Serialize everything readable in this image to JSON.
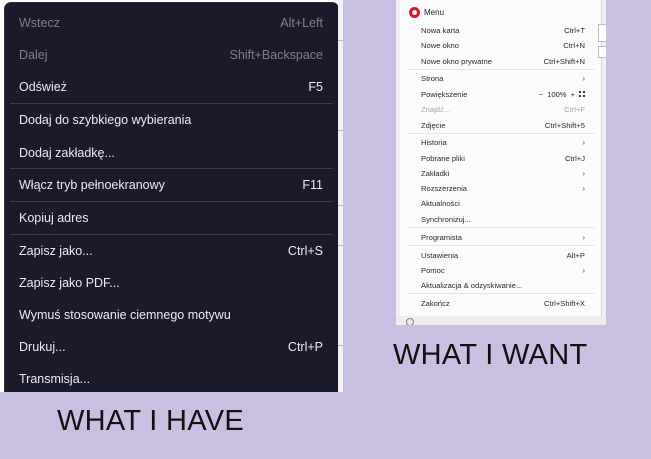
{
  "dark_menu": {
    "items": [
      {
        "label": "Wstecz",
        "shortcut": "Alt+Left",
        "disabled": true
      },
      {
        "label": "Dalej",
        "shortcut": "Shift+Backspace",
        "disabled": true
      },
      {
        "label": "Odśwież",
        "shortcut": "F5",
        "disabled": false
      },
      {
        "label": "Dodaj do szybkiego wybierania",
        "shortcut": "",
        "disabled": false
      },
      {
        "label": "Dodaj zakładkę...",
        "shortcut": "",
        "disabled": false
      },
      {
        "label": "Włącz tryb pełnoekranowy",
        "shortcut": "F11",
        "disabled": false
      },
      {
        "label": "Kopiuj adres",
        "shortcut": "",
        "disabled": false
      },
      {
        "label": "Zapisz jako...",
        "shortcut": "Ctrl+S",
        "disabled": false
      },
      {
        "label": "Zapisz jako PDF...",
        "shortcut": "",
        "disabled": false
      },
      {
        "label": "Wymuś stosowanie ciemnego motywu",
        "shortcut": "",
        "disabled": false
      },
      {
        "label": "Drukuj...",
        "shortcut": "Ctrl+P",
        "disabled": false
      },
      {
        "label": "Transmisja...",
        "shortcut": "",
        "disabled": false
      }
    ]
  },
  "light_menu": {
    "title": "Menu",
    "zoom_value": "100%",
    "zoom_minus": "−",
    "zoom_plus": "+",
    "items": [
      {
        "label": "Nowa karta",
        "shortcut": "Ctrl+T"
      },
      {
        "label": "Nowe okno",
        "shortcut": "Ctrl+N"
      },
      {
        "label": "Nowe okno prywatne",
        "shortcut": "Ctrl+Shift+N"
      },
      {
        "label": "Strona",
        "shortcut": "›"
      },
      {
        "label": "Powiększenie",
        "shortcut": ""
      },
      {
        "label": "Znajdź...",
        "shortcut": "Ctrl+F"
      },
      {
        "label": "Zdjęcie",
        "shortcut": "Ctrl+Shift+5"
      },
      {
        "label": "Historia",
        "shortcut": "›"
      },
      {
        "label": "Pobrane pliki",
        "shortcut": "Ctrl+J"
      },
      {
        "label": "Zakładki",
        "shortcut": "›"
      },
      {
        "label": "Rozszerzenia",
        "shortcut": "›"
      },
      {
        "label": "Aktualności",
        "shortcut": ""
      },
      {
        "label": "Synchronizuj...",
        "shortcut": ""
      },
      {
        "label": "Programista",
        "shortcut": "›"
      },
      {
        "label": "Ustawienia",
        "shortcut": "Alt+P"
      },
      {
        "label": "Pomoc",
        "shortcut": "›"
      },
      {
        "label": "Aktualizacja & odzyskiwanie...",
        "shortcut": ""
      },
      {
        "label": "Zakończ",
        "shortcut": "Ctrl+Shift+X"
      }
    ]
  },
  "captions": {
    "have": "WHAT I HAVE",
    "want": "WHAT I WANT"
  },
  "colors": {
    "background": "#c9bfe3",
    "dark_menu_bg": "#1b1a2b",
    "opera_red": "#e0121c"
  }
}
